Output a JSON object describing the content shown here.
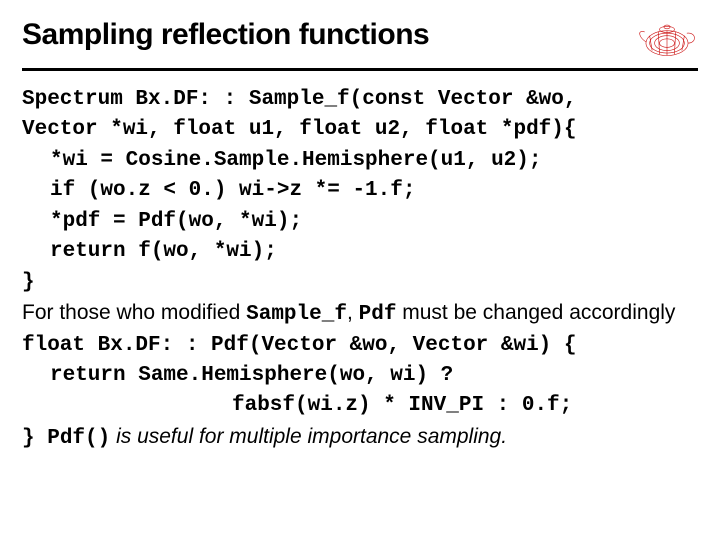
{
  "header": {
    "title": "Sampling reflection functions",
    "logo": "teapot-icon"
  },
  "code1": {
    "l1": "Spectrum Bx.DF: : Sample_f(const Vector &wo,",
    "l2": "Vector *wi, float u1, float u2, float *pdf){",
    "l3": "*wi = Cosine.Sample.Hemisphere(u1, u2);",
    "l4": "if (wo.z < 0.) wi->z *= -1.f;",
    "l5": "*pdf = Pdf(wo, *wi);",
    "l6": "return f(wo, *wi);",
    "l7": "}"
  },
  "prose1": {
    "pre": "For those who modified ",
    "mid_code1": "Sample_f",
    "mid": ", ",
    "mid_code2": "Pdf",
    "post": " must be changed accordingly"
  },
  "code2": {
    "l1": "float Bx.DF: : Pdf(Vector &wo, Vector &wi) {",
    "l2": "return Same.Hemisphere(wo, wi) ?",
    "l3": "fabsf(wi.z) * INV_PI : 0.f;",
    "l4a": "} ",
    "l4b_code": "Pdf()",
    "l4b_prose": " is useful for multiple importance sampling."
  }
}
